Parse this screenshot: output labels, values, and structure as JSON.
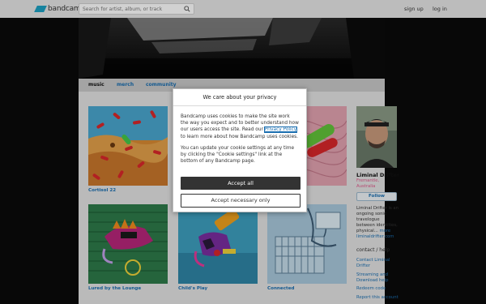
{
  "header": {
    "logo_text": "bandcamp",
    "search_placeholder": "Search for artist, album, or track",
    "signup_label": "sign up",
    "login_label": "log in"
  },
  "tabs": [
    {
      "label": "music",
      "active": true
    },
    {
      "label": "merch",
      "active": false
    },
    {
      "label": "community",
      "active": false
    }
  ],
  "albums": [
    {
      "title": "Cortisol 22"
    },
    {
      "title": "Lured by the Lounge"
    },
    {
      "title": "Child's Play"
    },
    {
      "title": "Connected"
    }
  ],
  "artist": {
    "name": "Liminal Drifter",
    "location_line1": "Fremantle,",
    "location_line2": "Australia",
    "follow_label": "Follow",
    "bio_line1": "Liminal Drifter is an",
    "bio_line2": "ongoing sonic",
    "bio_line3": "travelogue",
    "bio_line4": "between identities,",
    "bio_line5": "physical...",
    "bio_more": "more",
    "website": "liminaldrifter.com"
  },
  "contact": {
    "heading": "contact / help",
    "links": [
      {
        "line1": "Contact Liminal",
        "line2": "Drifter"
      },
      {
        "line1": "Streaming and",
        "line2": "Download help"
      },
      {
        "line1": "Redeem code",
        "line2": ""
      },
      {
        "line1": "Report this account",
        "line2": ""
      }
    ]
  },
  "dialog": {
    "title": "We care about your privacy",
    "para1_before": "Bandcamp uses cookies to make the site work the way you expect and to better understand how our users access the site. Read our ",
    "para1_link": "Privacy Policy",
    "para1_after": " to learn more about how Bandcamp uses cookies.",
    "para2": "You can update your cookie settings at any time by clicking the \"Cookie settings\" link at the bottom of any Bandcamp page.",
    "accept_label": "Accept all",
    "necessary_label": "Accept necessary only"
  },
  "colors": {
    "link": "#1a6eb0",
    "location": "#e0578a",
    "brand": "#1da0c3"
  }
}
